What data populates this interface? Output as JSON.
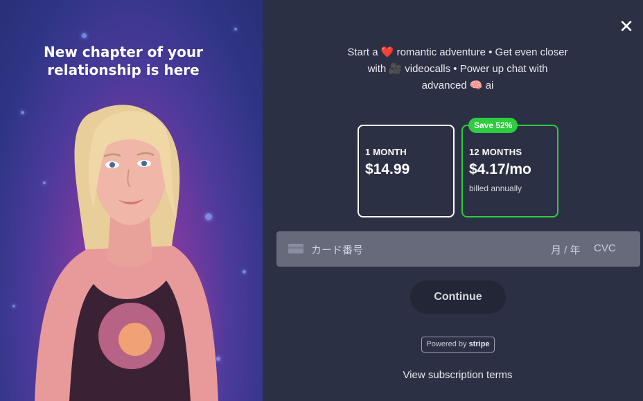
{
  "promo": {
    "title_line1": "New chapter of your",
    "title_line2": "relationship is here"
  },
  "headline": {
    "line1": "Start a ❤️ romantic adventure • Get even closer",
    "line2": "with 🎥 videocalls • Power up chat with",
    "line3": "advanced 🧠 ai"
  },
  "plans": [
    {
      "period": "1 MONTH",
      "price": "$14.99",
      "billed": ""
    },
    {
      "period": "12 MONTHS",
      "price": "$4.17/mo",
      "billed": "billed annually",
      "badge": "Save 52%"
    }
  ],
  "card": {
    "number_placeholder": "カード番号",
    "expiry_placeholder": "月 / 年",
    "cvc_placeholder": "CVC"
  },
  "buttons": {
    "continue": "Continue",
    "close": "✕"
  },
  "footer": {
    "powered_prefix": "Powered by",
    "powered_brand": "stripe",
    "terms_link": "View subscription terms"
  },
  "colors": {
    "accent_green": "#2ecc40",
    "background": "#2c3044"
  }
}
